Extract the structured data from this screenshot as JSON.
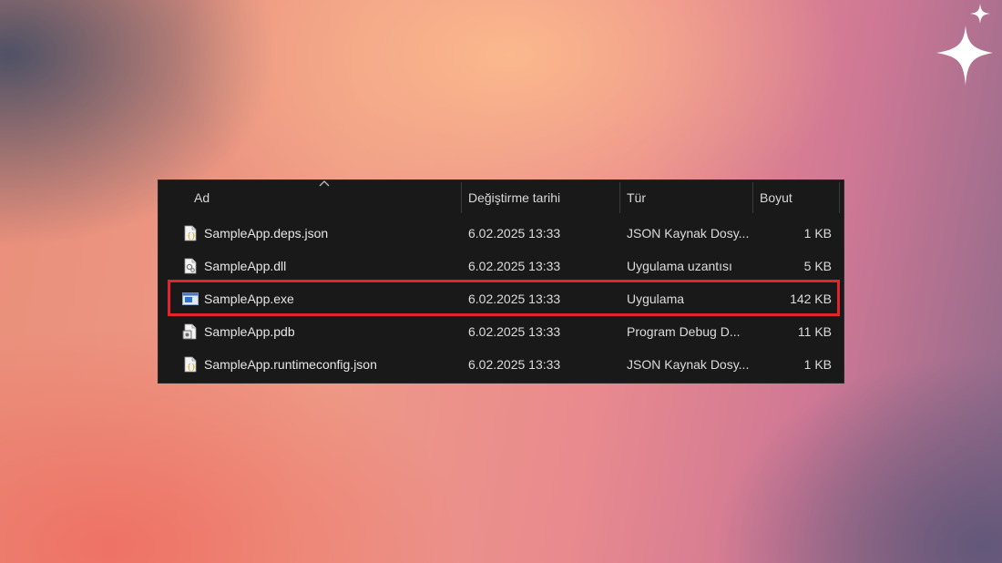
{
  "columns": {
    "name": "Ad",
    "modified": "Değiştirme tarihi",
    "type": "Tür",
    "size": "Boyut"
  },
  "files": [
    {
      "name": "SampleApp.deps.json",
      "modified": "6.02.2025 13:33",
      "type": "JSON Kaynak Dosy...",
      "size": "1 KB",
      "icon": "json-file-icon"
    },
    {
      "name": "SampleApp.dll",
      "modified": "6.02.2025 13:33",
      "type": "Uygulama uzantısı",
      "size": "5 KB",
      "icon": "dll-file-icon"
    },
    {
      "name": "SampleApp.exe",
      "modified": "6.02.2025 13:33",
      "type": "Uygulama",
      "size": "142 KB",
      "icon": "exe-file-icon"
    },
    {
      "name": "SampleApp.pdb",
      "modified": "6.02.2025 13:33",
      "type": "Program Debug D...",
      "size": "11 KB",
      "icon": "pdb-file-icon"
    },
    {
      "name": "SampleApp.runtimeconfig.json",
      "modified": "6.02.2025 13:33",
      "type": "JSON Kaynak Dosy...",
      "size": "1 KB",
      "icon": "json-file-icon"
    }
  ],
  "highlight_color": "#e3242b",
  "sort_indicator_icon": "sort-ascending-icon"
}
